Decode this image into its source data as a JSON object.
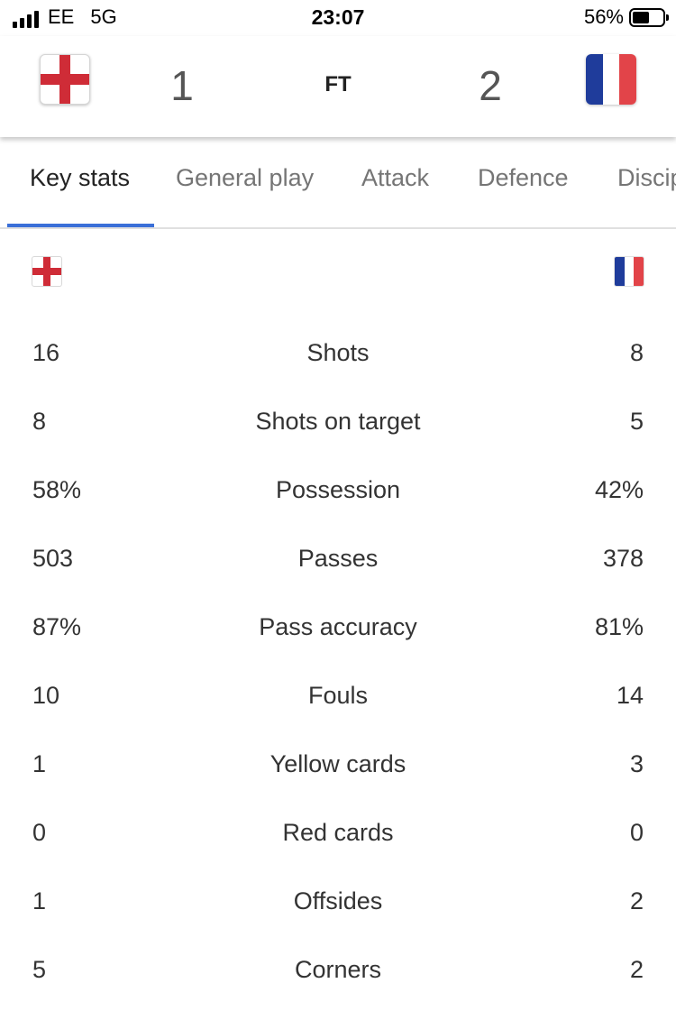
{
  "status_bar": {
    "carrier": "EE",
    "network": "5G",
    "time": "23:07",
    "battery_percent": "56%",
    "battery_level": 0.56
  },
  "match": {
    "home_team_flag": "england-flag-icon",
    "away_team_flag": "france-flag-icon",
    "home_score": "1",
    "away_score": "2",
    "status": "FT"
  },
  "tabs": [
    {
      "label": "Key stats",
      "active": true
    },
    {
      "label": "General play",
      "active": false
    },
    {
      "label": "Attack",
      "active": false
    },
    {
      "label": "Defence",
      "active": false
    },
    {
      "label": "Discipline",
      "active": false
    }
  ],
  "colors": {
    "england_red": "#cf2c37",
    "france_blue": "#1f3c9b",
    "france_red": "#e24449",
    "tab_indicator": "#3a6fd8"
  },
  "stats": [
    {
      "label": "Shots",
      "home": "16",
      "away": "8"
    },
    {
      "label": "Shots on target",
      "home": "8",
      "away": "5"
    },
    {
      "label": "Possession",
      "home": "58%",
      "away": "42%"
    },
    {
      "label": "Passes",
      "home": "503",
      "away": "378"
    },
    {
      "label": "Pass accuracy",
      "home": "87%",
      "away": "81%"
    },
    {
      "label": "Fouls",
      "home": "10",
      "away": "14"
    },
    {
      "label": "Yellow cards",
      "home": "1",
      "away": "3"
    },
    {
      "label": "Red cards",
      "home": "0",
      "away": "0"
    },
    {
      "label": "Offsides",
      "home": "1",
      "away": "2"
    },
    {
      "label": "Corners",
      "home": "5",
      "away": "2"
    }
  ]
}
